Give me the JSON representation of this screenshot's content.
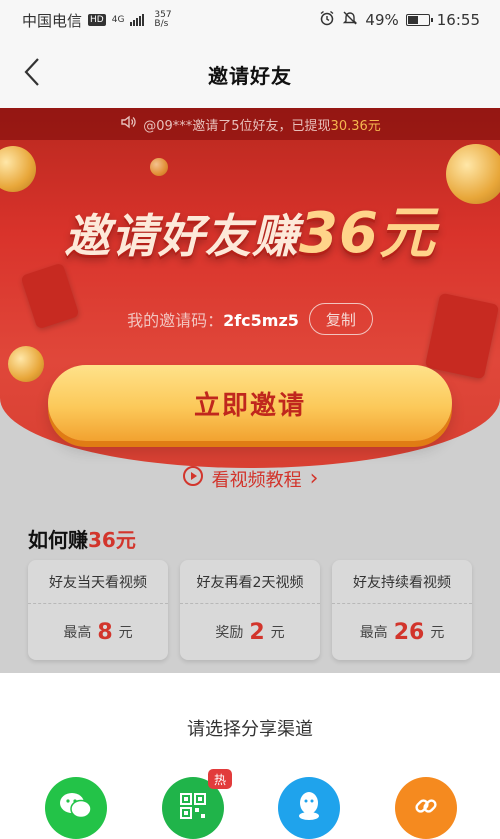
{
  "status_bar": {
    "carrier": "中国电信",
    "hd": "HD",
    "network": "4G",
    "speed_value": "357",
    "speed_unit": "B/s",
    "battery_percent": "49%",
    "battery_level": 0.49,
    "time": "16:55"
  },
  "nav": {
    "back_icon": "chevron-left-icon",
    "title": "邀请好友"
  },
  "ticker": {
    "icon": "speaker-icon",
    "prefix": "@09***邀请了5位好友，已提现",
    "amount": "30.36元"
  },
  "hero": {
    "headline_prefix": "邀请好友赚",
    "headline_amount": "36元",
    "code_label": "我的邀请码：",
    "code_value": "2fc5mz5",
    "copy_label": "复制",
    "invite_button": "立即邀请",
    "video_link": "看视频教程",
    "video_chevron": "›"
  },
  "earn": {
    "title_prefix": "如何赚",
    "title_amount": "36元",
    "cards": [
      {
        "top": "好友当天看视频",
        "label": "最高",
        "num": "8",
        "unit": "元"
      },
      {
        "top": "好友再看2天视频",
        "label": "奖励",
        "num": "2",
        "unit": "元"
      },
      {
        "top": "好友持续看视频",
        "label": "最高",
        "num": "26",
        "unit": "元"
      }
    ]
  },
  "share": {
    "title": "请选择分享渠道",
    "channels": [
      {
        "icon": "wechat-icon",
        "color": "#23c348"
      },
      {
        "icon": "qrcode-icon",
        "color": "#20b44a",
        "badge": "热"
      },
      {
        "icon": "qq-icon",
        "color": "#1fa3ec"
      },
      {
        "icon": "link-icon",
        "color": "#f58a1f"
      }
    ]
  }
}
